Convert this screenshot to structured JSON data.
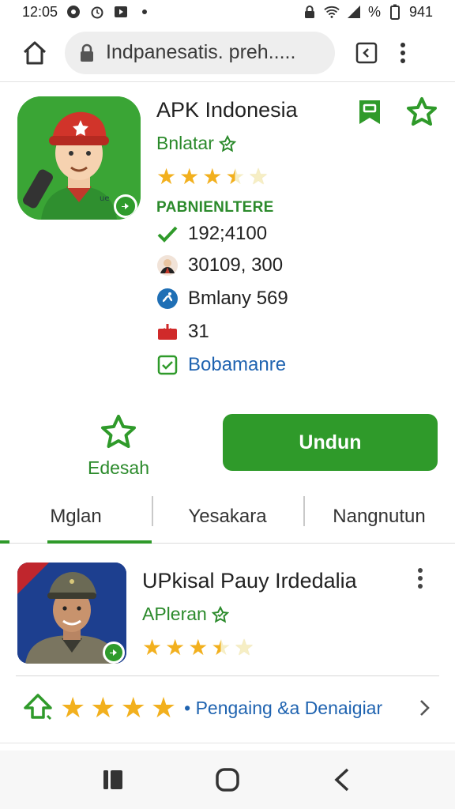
{
  "status_bar": {
    "time": "12:05",
    "right_text": "%",
    "battery": "941"
  },
  "browser": {
    "url": "Indpanesatis. preh.....",
    "icons": [
      "home-icon",
      "lock-icon",
      "tab-switcher-icon",
      "more-vert-icon"
    ]
  },
  "app": {
    "title": "APK Indonesia",
    "developer": "Bnlatar",
    "rating_stars": 3.5,
    "category": "PABNIENLTERE",
    "info": [
      {
        "icon": "check-icon",
        "text": "192;4100"
      },
      {
        "icon": "user-avatar-icon",
        "text": "30109, 300"
      },
      {
        "icon": "size-icon",
        "text": "Bmlany 569"
      },
      {
        "icon": "download-icon",
        "text": "31"
      },
      {
        "icon": "checkbox-icon",
        "text": "Bobamanre"
      }
    ],
    "wishlist_label": "Edesah",
    "install_label": "Undun"
  },
  "tabs": [
    {
      "label": "Mglan",
      "active": true
    },
    {
      "label": "Yesakara",
      "active": false
    },
    {
      "label": "Nangnutun",
      "active": false
    }
  ],
  "related": {
    "title": "UPkisal Pauy Irdedalia",
    "developer": "APleran",
    "rating_stars": 4
  },
  "rating_row": {
    "stars": 4,
    "separator": "•",
    "link": "Pengaing &a Denaigiar"
  },
  "colors": {
    "accent": "#2f9a2a",
    "star": "#f2b01e",
    "link": "#1f63b0"
  }
}
